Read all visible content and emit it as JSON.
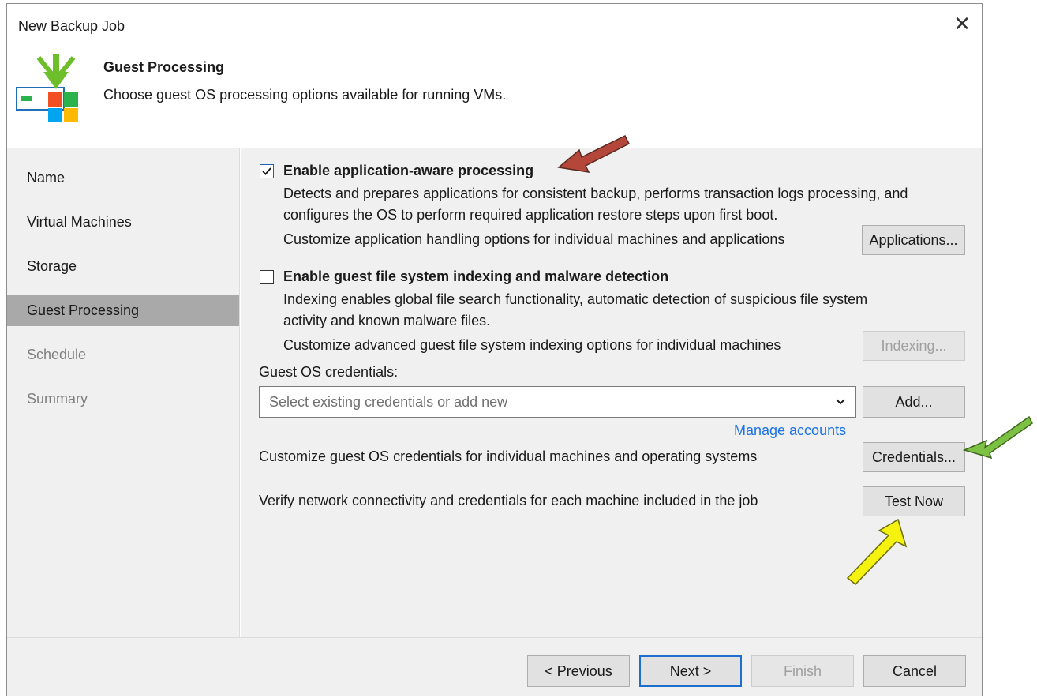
{
  "window": {
    "title": "New Backup Job"
  },
  "header": {
    "title": "Guest Processing",
    "subtitle": "Choose guest OS processing options available for running VMs."
  },
  "steps": [
    {
      "label": "Name",
      "state": "normal"
    },
    {
      "label": "Virtual Machines",
      "state": "normal"
    },
    {
      "label": "Storage",
      "state": "normal"
    },
    {
      "label": "Guest Processing",
      "state": "active"
    },
    {
      "label": "Schedule",
      "state": "disabled"
    },
    {
      "label": "Summary",
      "state": "disabled"
    }
  ],
  "app_aware": {
    "checked": true,
    "label": "Enable application-aware processing",
    "desc1": "Detects and prepares applications for consistent backup, performs transaction logs processing, and",
    "desc2": "configures the OS to perform required application restore steps upon first boot.",
    "customize": "Customize application handling options for individual machines and applications",
    "button": "Applications..."
  },
  "indexing": {
    "checked": false,
    "label": "Enable guest file system indexing and malware detection",
    "desc1": "Indexing enables global file search functionality, automatic detection of suspicious file system",
    "desc2": "activity and known malware files.",
    "customize": "Customize advanced guest file system indexing options for individual machines",
    "button": "Indexing..."
  },
  "credentials": {
    "label": "Guest OS credentials:",
    "placeholder": "Select existing credentials or add new",
    "add_button": "Add...",
    "manage_link": "Manage accounts",
    "customize": "Customize guest OS credentials for individual machines and operating systems",
    "credentials_button": "Credentials...",
    "verify": "Verify network connectivity and credentials for each machine included in the job",
    "test_button": "Test Now"
  },
  "footer": {
    "previous": "< Previous",
    "next": "Next >",
    "finish": "Finish",
    "cancel": "Cancel"
  },
  "icons": {
    "close": "close-icon",
    "header": "backup-job-icon",
    "dropdown": "chevron-down-icon"
  },
  "colors": {
    "accent": "#1c6fcf",
    "link": "#1a73e8",
    "annotation_red": "#b5473a",
    "annotation_green": "#7cc144",
    "annotation_yellow": "#f4f20e"
  }
}
